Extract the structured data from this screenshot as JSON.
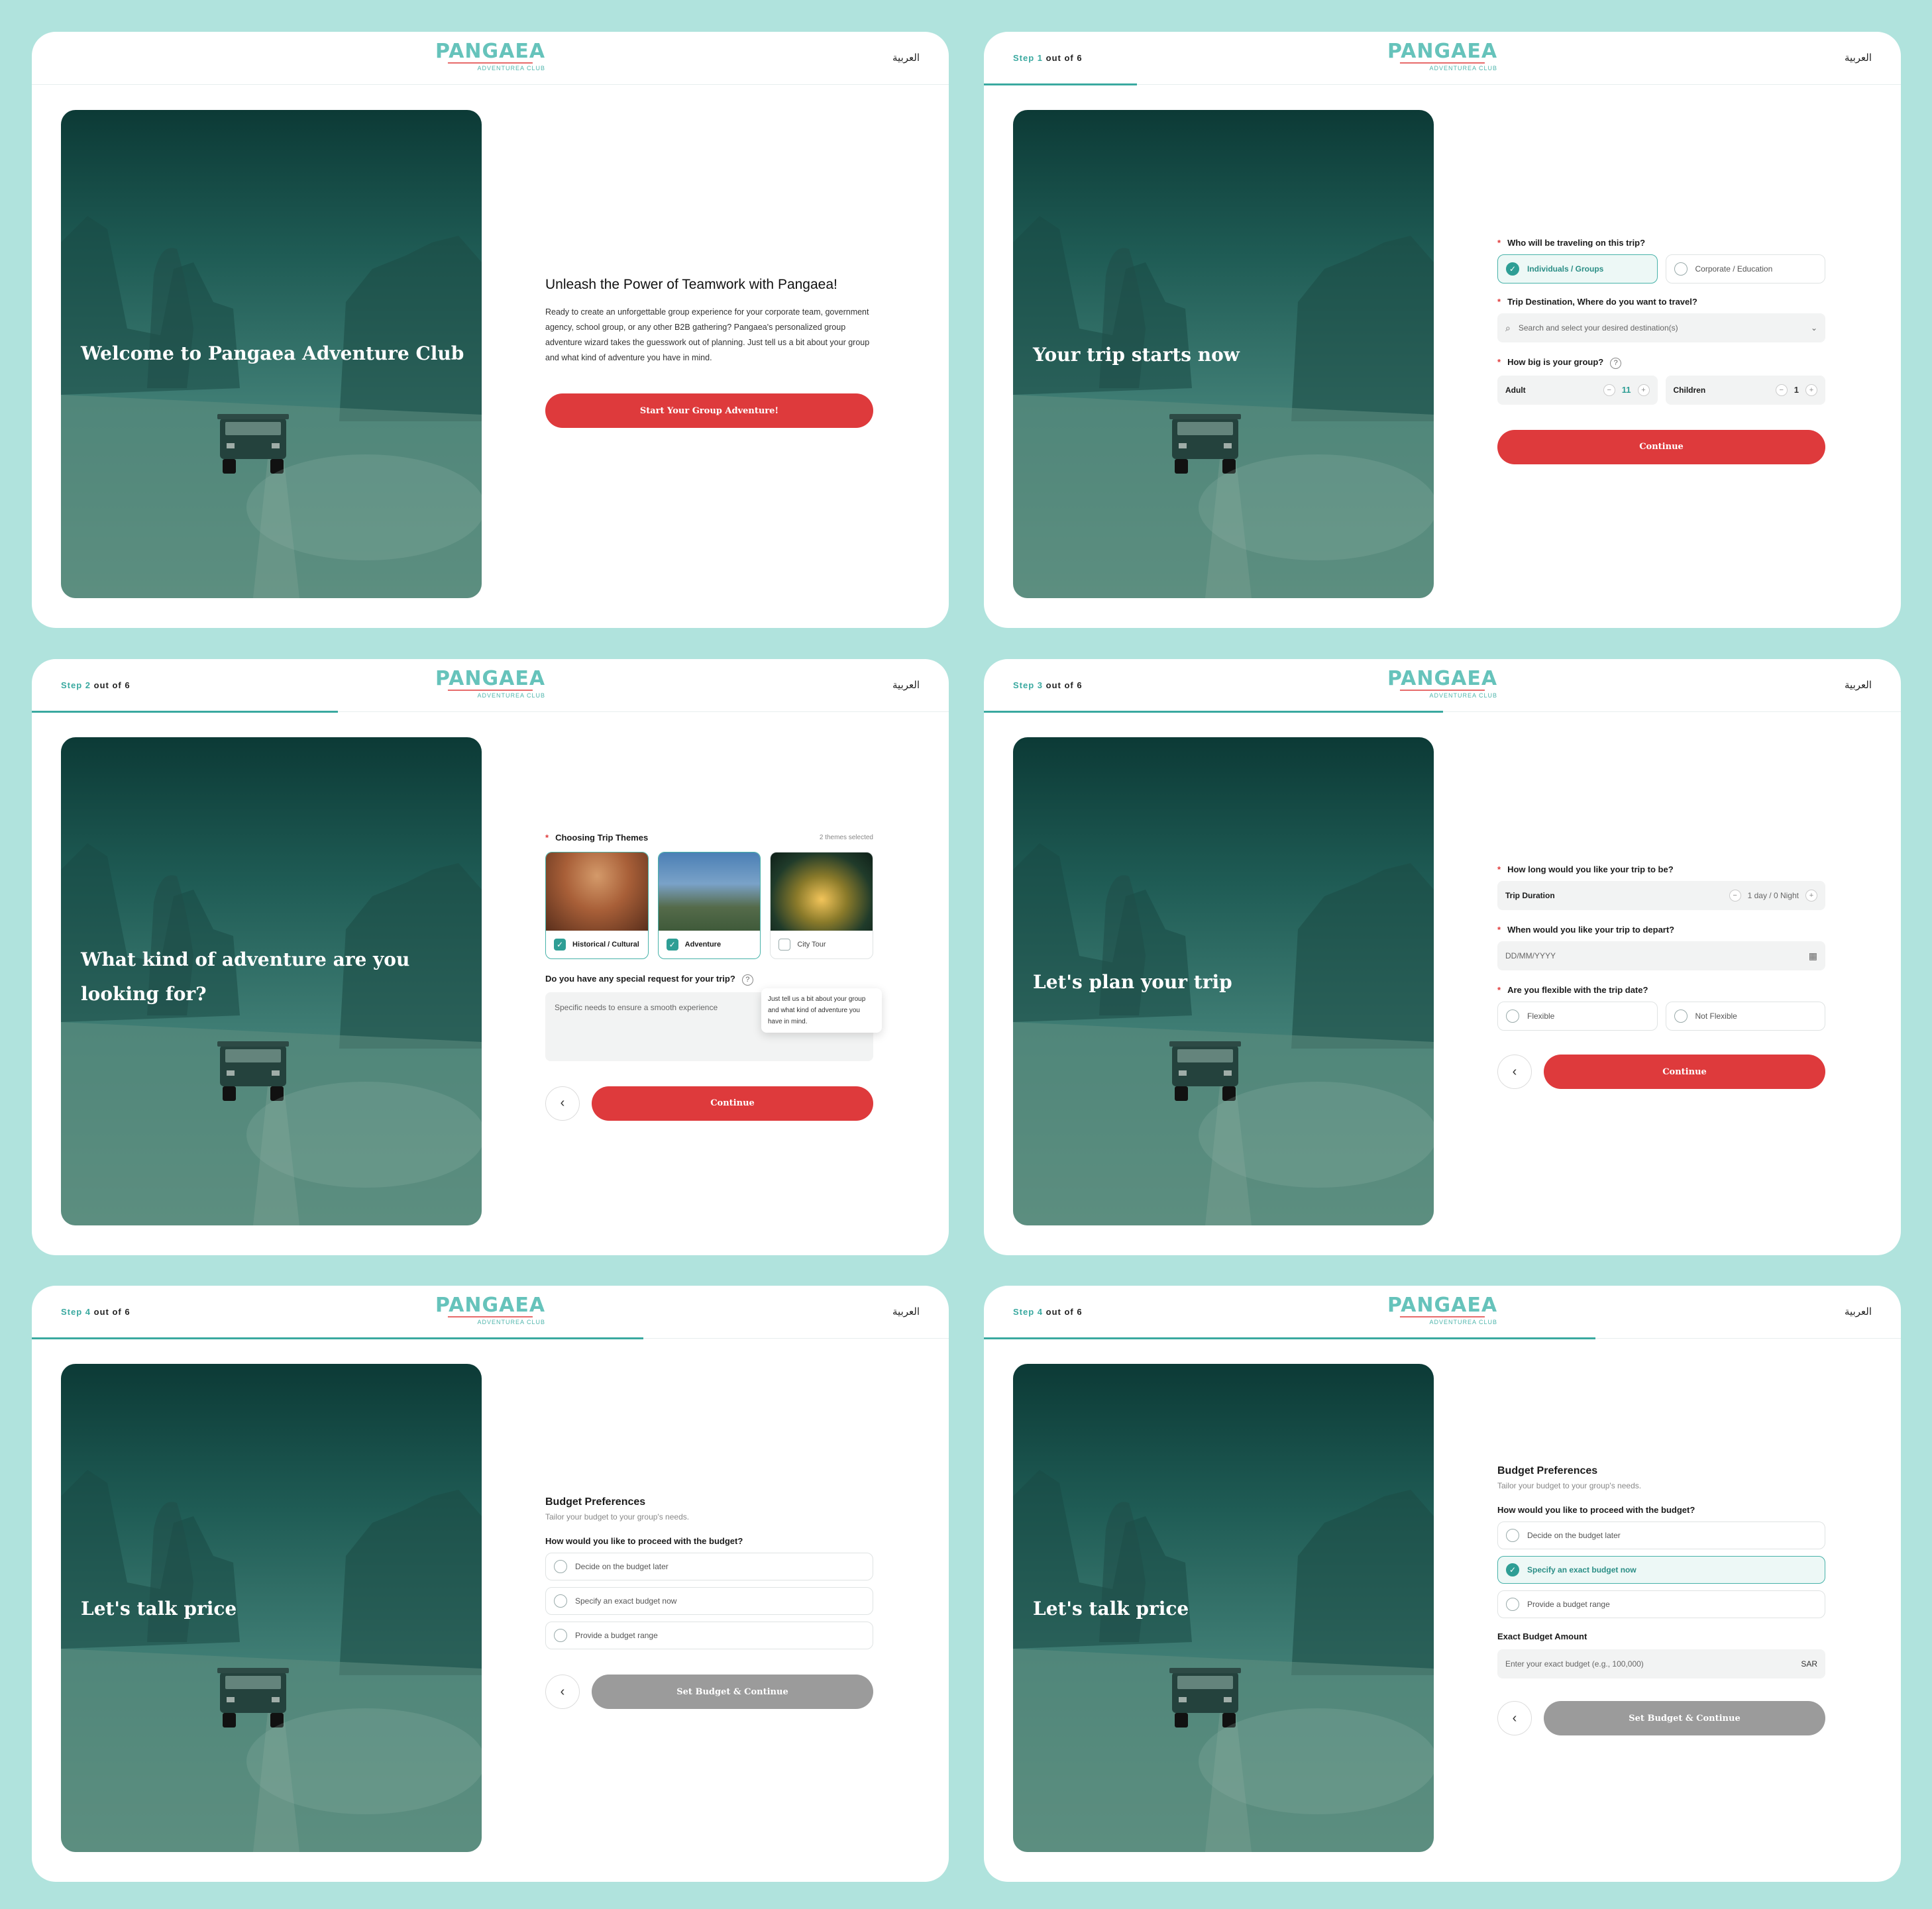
{
  "brand": {
    "logo_word": "PANGAEA",
    "logo_sub": "ADVENTUREA CLUB",
    "lang_toggle": "العربية"
  },
  "step_label": {
    "prefix": "Step",
    "suffix": "out of 6"
  },
  "screens": {
    "welcome": {
      "hero_title": "Welcome to Pangaea Adventure Club",
      "heading": "Unleash the Power of Teamwork with Pangaea!",
      "body": "Ready to create an unforgettable group experience for your corporate team, government agency, school group, or any other B2B gathering?  Pangaea's personalized group adventure wizard takes the guesswork out of planning.  Just tell us a bit about your group and what kind of adventure you have in mind.",
      "cta": "Start Your Group Adventure!"
    },
    "step1": {
      "step_number": "1",
      "progress": 0.167,
      "hero_title": "Your trip starts now",
      "q_travelers": "Who will be traveling on this trip?",
      "opt_individuals": "Individuals / Groups",
      "opt_corporate": "Corporate / Education",
      "q_destination": "Trip Destination, Where do you want to travel?",
      "destination_placeholder": "Search and select your desired destination(s)",
      "q_group_size": "How big is your group?",
      "adult_label": "Adult",
      "adult_count": "11",
      "children_label": "Children",
      "children_count": "1",
      "continue": "Continue"
    },
    "step2": {
      "step_number": "2",
      "progress": 0.333,
      "hero_title": "What kind of adventure are you looking for?",
      "q_themes": "Choosing Trip Themes",
      "themes_count": "2 themes selected",
      "themes": [
        {
          "label": "Historical / Cultural",
          "checked": true
        },
        {
          "label": "Adventure",
          "checked": true
        },
        {
          "label": "City Tour",
          "checked": false
        }
      ],
      "q_special": "Do you have any special request for your trip?",
      "special_placeholder": "Specific needs to ensure a smooth experience",
      "tooltip": "Just tell us a bit about your group and what kind of adventure you have in mind.",
      "continue": "Continue"
    },
    "step3": {
      "step_number": "3",
      "progress": 0.5,
      "hero_title": "Let's plan your trip",
      "q_duration": "How long would you like your trip to be?",
      "duration_label": "Trip Duration",
      "duration_value": "1 day / 0 Night",
      "q_depart": "When would you like your trip to depart?",
      "date_placeholder": "DD/MM/YYYY",
      "q_flexible": "Are you flexible with the trip date?",
      "opt_flexible": "Flexible",
      "opt_not_flexible": "Not Flexible",
      "continue": "Continue"
    },
    "step4a": {
      "step_number": "4",
      "progress": 0.667,
      "hero_title": "Let's talk price",
      "heading": "Budget Preferences",
      "subheading": "Tailor your budget to your group's needs.",
      "q_budget": "How would you like to proceed with the budget?",
      "options": [
        "Decide on the budget later",
        "Specify an exact budget now",
        "Provide a budget range"
      ],
      "cta": "Set Budget & Continue"
    },
    "step4b": {
      "step_number": "4",
      "progress": 0.667,
      "hero_title": "Let's talk price",
      "heading": "Budget Preferences",
      "subheading": "Tailor your budget to your group's needs.",
      "q_budget": "How would you like to proceed with the budget?",
      "options": [
        "Decide on the budget later",
        "Specify an exact budget now",
        "Provide a budget range"
      ],
      "selected_option": "Specify an exact budget now",
      "exact_label": "Exact Budget Amount",
      "exact_placeholder": "Enter your exact budget (e.g., 100,000)",
      "currency": "SAR",
      "cta": "Set Budget & Continue"
    }
  },
  "colors": {
    "background": "#b0e3dd",
    "brand_teal": "#66c3bb",
    "accent_red": "#de3a3c",
    "progress": "#3aa9a0"
  }
}
